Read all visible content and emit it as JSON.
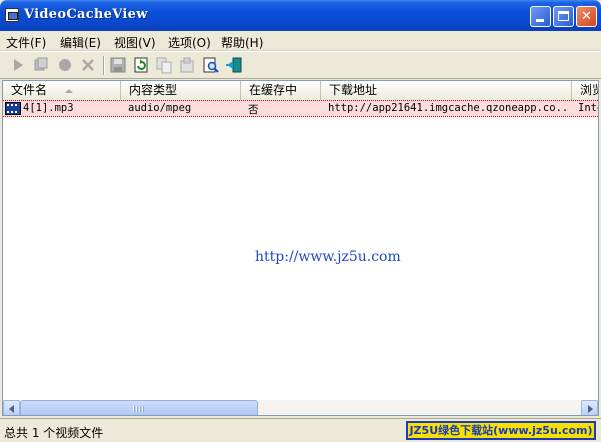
{
  "window": {
    "title": "VideoCacheView"
  },
  "menu": [
    {
      "label": "文件(F)"
    },
    {
      "label": "编辑(E)"
    },
    {
      "label": "视图(V)"
    },
    {
      "label": "选项(O)"
    },
    {
      "label": "帮助(H)"
    }
  ],
  "toolbar": {
    "icons": [
      "play-icon",
      "play-with-icon",
      "stop-icon",
      "delete-icon",
      "save-icon",
      "refresh-icon",
      "copy-icon",
      "properties-icon",
      "find-icon",
      "exit-icon"
    ]
  },
  "columns": [
    {
      "label": "文件名"
    },
    {
      "label": "内容类型"
    },
    {
      "label": "在缓存中"
    },
    {
      "label": "下载地址"
    },
    {
      "label": "浏览"
    }
  ],
  "rows": [
    {
      "filename": "4[1].mp3",
      "content_type": "audio/mpeg",
      "in_cache": "否",
      "url": "http://app21641.imgcache.qzoneapp.co...",
      "browser": "Inte"
    }
  ],
  "watermark": "http://www.jz5u.com",
  "status": {
    "text": "总共 1 个视频文件",
    "badge": "JZ5U绿色下载站(www.jz5u.com)"
  }
}
